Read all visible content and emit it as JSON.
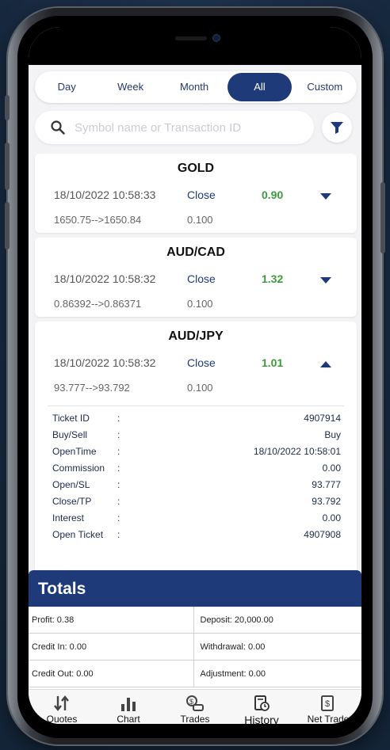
{
  "period_tabs": [
    {
      "label": "Day"
    },
    {
      "label": "Week"
    },
    {
      "label": "Month"
    },
    {
      "label": "All"
    },
    {
      "label": "Custom"
    }
  ],
  "active_tab": "All",
  "search": {
    "placeholder": "Symbol name or Transaction ID",
    "value": ""
  },
  "trades": [
    {
      "symbol": "GOLD",
      "time": "18/10/2022 10:58:33",
      "type": "Close",
      "profit": "0.90",
      "price": "1650.75-->1650.84",
      "volume": "0.100",
      "expanded": false
    },
    {
      "symbol": "AUD/CAD",
      "time": "18/10/2022 10:58:32",
      "type": "Close",
      "profit": "1.32",
      "price": "0.86392-->0.86371",
      "volume": "0.100",
      "expanded": false
    },
    {
      "symbol": "AUD/JPY",
      "time": "18/10/2022 10:58:32",
      "type": "Close",
      "profit": "1.01",
      "price": "93.777-->93.792",
      "volume": "0.100",
      "expanded": true
    }
  ],
  "trade_details": {
    "sep": ":",
    "rows": [
      {
        "key": "Ticket ID",
        "value": "4907914"
      },
      {
        "key": "Buy/Sell",
        "value": "Buy"
      },
      {
        "key": "OpenTime",
        "value": "18/10/2022 10:58:01"
      },
      {
        "key": "Commission",
        "value": "0.00"
      },
      {
        "key": "Open/SL",
        "value": "93.777"
      },
      {
        "key": "Close/TP",
        "value": "93.792"
      },
      {
        "key": "Interest",
        "value": "0.00"
      },
      {
        "key": "Open Ticket",
        "value": "4907908"
      }
    ]
  },
  "totals": {
    "title": "Totals",
    "profit": "Profit: 0.38",
    "deposit": "Deposit: 20,000.00",
    "credit_in": "Credit In: 0.00",
    "withdrawal": "Withdrawal: 0.00",
    "credit_out": "Credit Out: 0.00",
    "adjustment": "Adjustment: 0.00"
  },
  "nav": [
    {
      "label": "Quotes",
      "icon": "sort-arrows-icon"
    },
    {
      "label": "Chart",
      "icon": "bar-chart-icon"
    },
    {
      "label": "Trades",
      "icon": "trades-icon"
    },
    {
      "label": "History",
      "icon": "history-icon"
    },
    {
      "label": "Net Trade",
      "icon": "net-trade-icon"
    }
  ],
  "colors": {
    "accent": "#1f3a78",
    "profit_green": "#3b9a3b",
    "background": "#f3f3f5"
  }
}
